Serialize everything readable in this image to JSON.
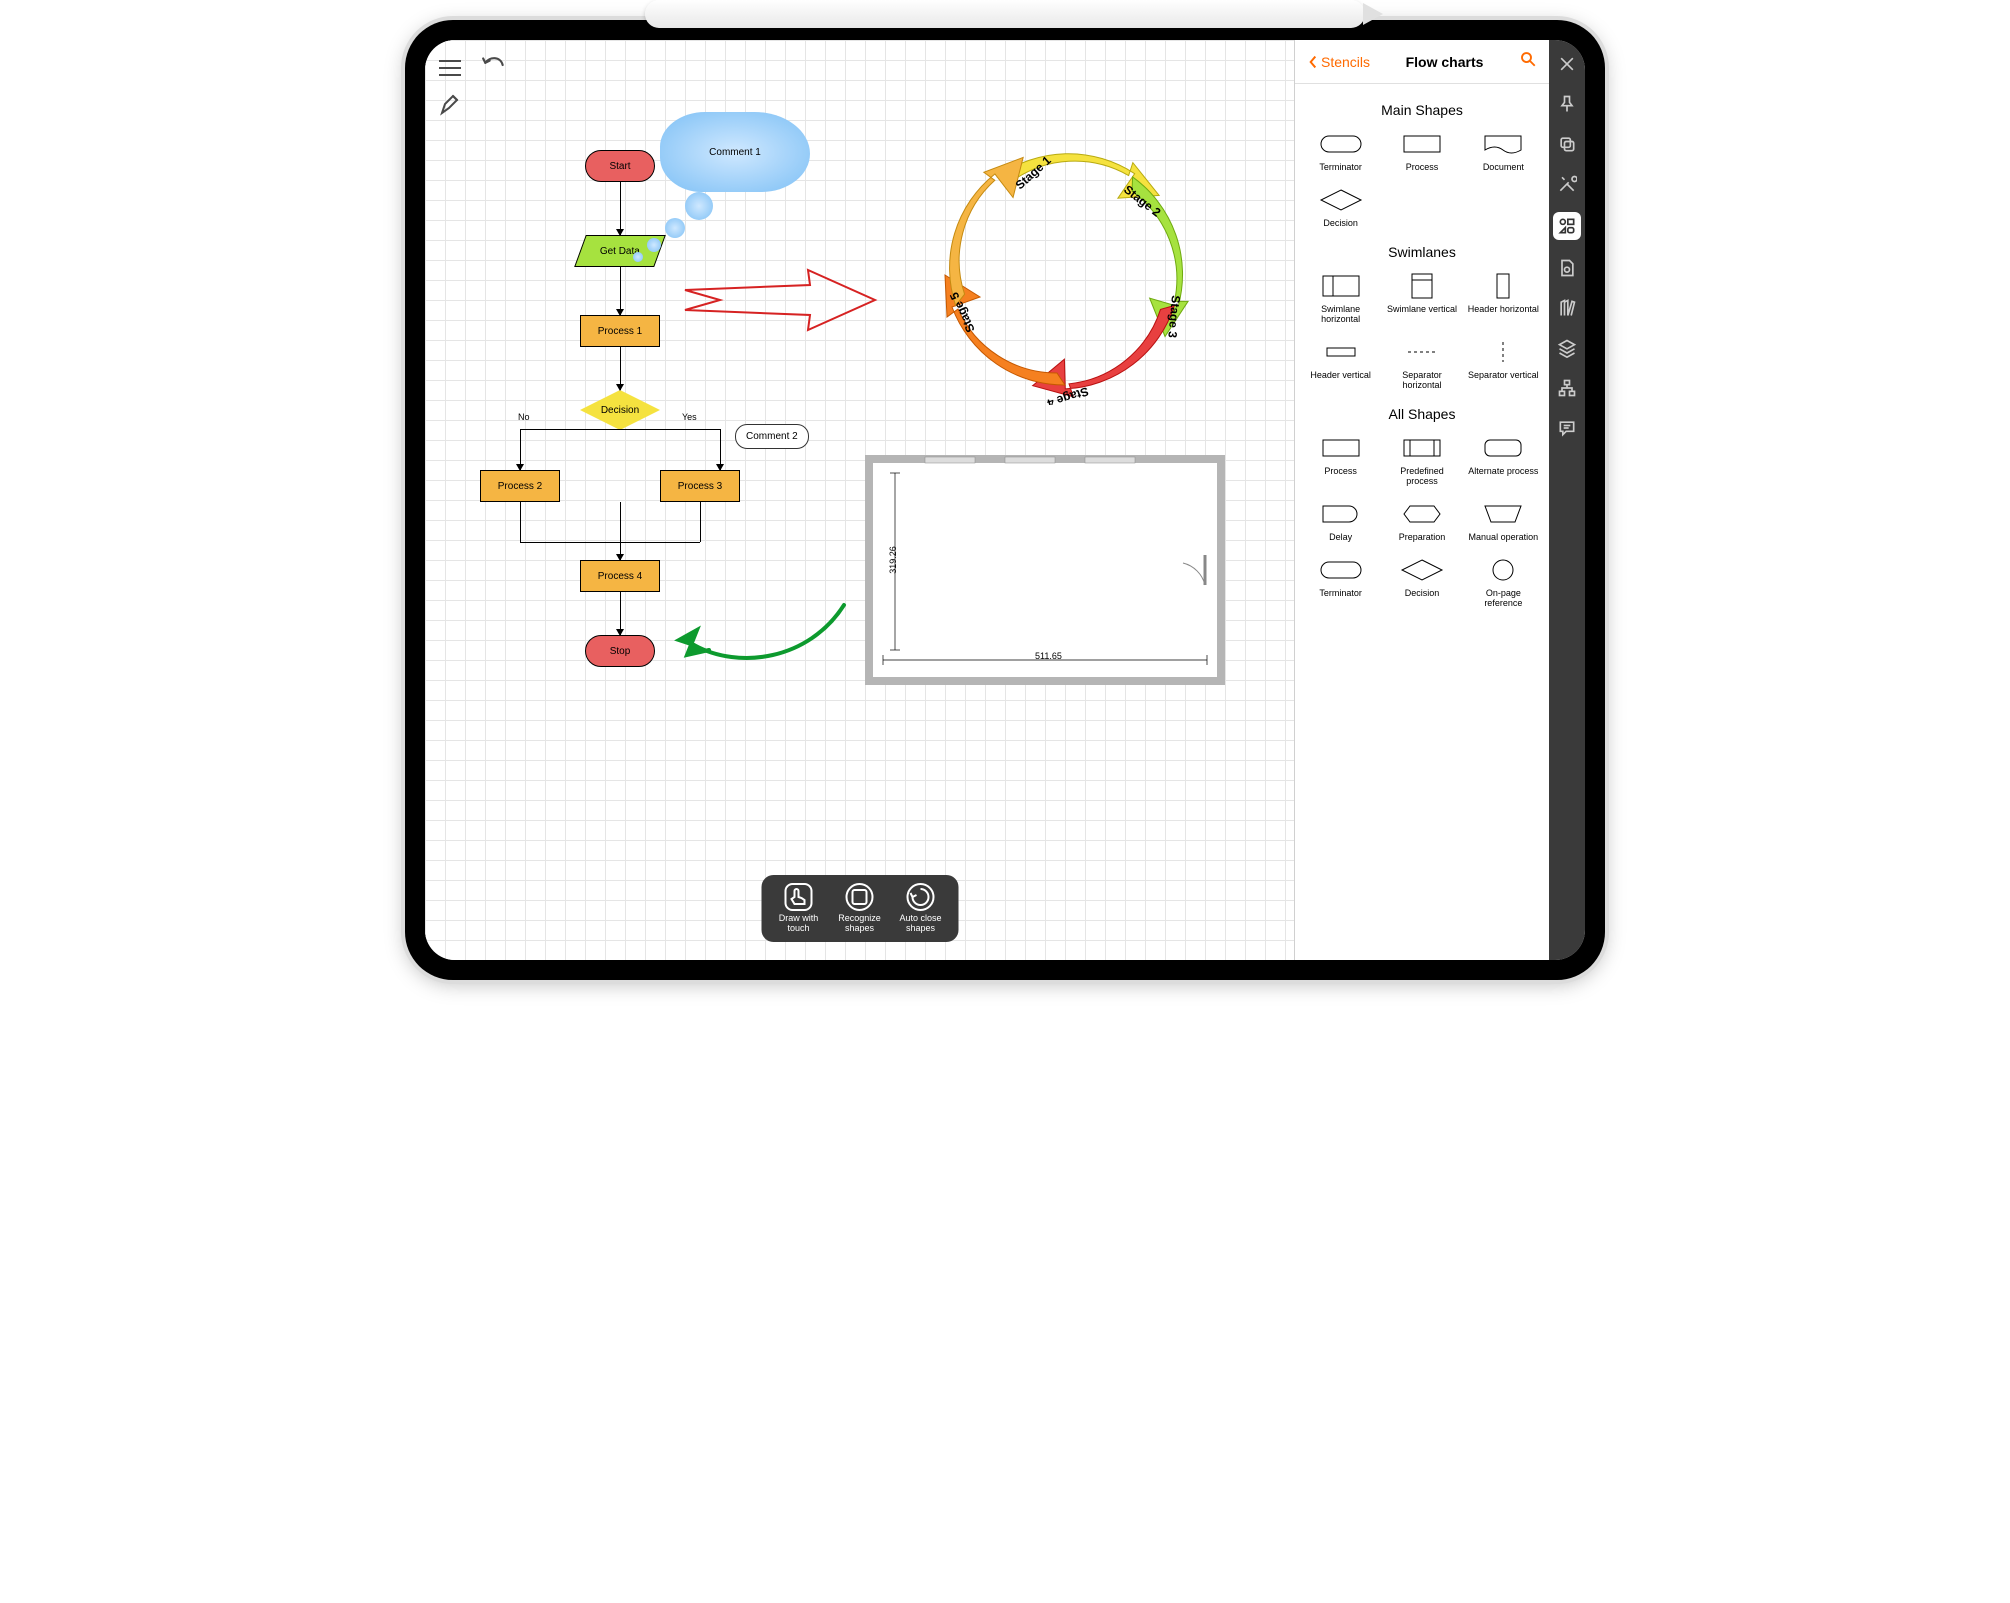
{
  "flowchart": {
    "start": "Start",
    "getData": "Get Data",
    "process1": "Process 1",
    "decision": "Decision",
    "decisionNo": "No",
    "decisionYes": "Yes",
    "process2": "Process 2",
    "process3": "Process 3",
    "process4": "Process 4",
    "stop": "Stop",
    "comment1": "Comment 1",
    "comment2": "Comment 2"
  },
  "cycle": {
    "stages": [
      "Stage 1",
      "Stage 2",
      "Stage 3",
      "Stage 4",
      "Stage 5"
    ]
  },
  "floorplan": {
    "width": "511.65",
    "height": "319.26"
  },
  "bottomToolbar": {
    "drawTouch": "Draw with touch",
    "recognize": "Recognize shapes",
    "autoClose": "Auto close shapes"
  },
  "stencils": {
    "back": "Stencils",
    "title": "Flow charts",
    "sections": {
      "main": {
        "title": "Main Shapes",
        "items": [
          "Terminator",
          "Process",
          "Document",
          "Decision"
        ]
      },
      "swim": {
        "title": "Swimlanes",
        "items": [
          "Swimlane horizontal",
          "Swimlane vertical",
          "Header horizontal",
          "Header vertical",
          "Separator horizontal",
          "Separator vertical"
        ]
      },
      "all": {
        "title": "All Shapes",
        "items": [
          "Process",
          "Predefined process",
          "Alternate process",
          "Delay",
          "Preparation",
          "Manual operation",
          "Terminator",
          "Decision",
          "On-page reference"
        ]
      }
    }
  }
}
